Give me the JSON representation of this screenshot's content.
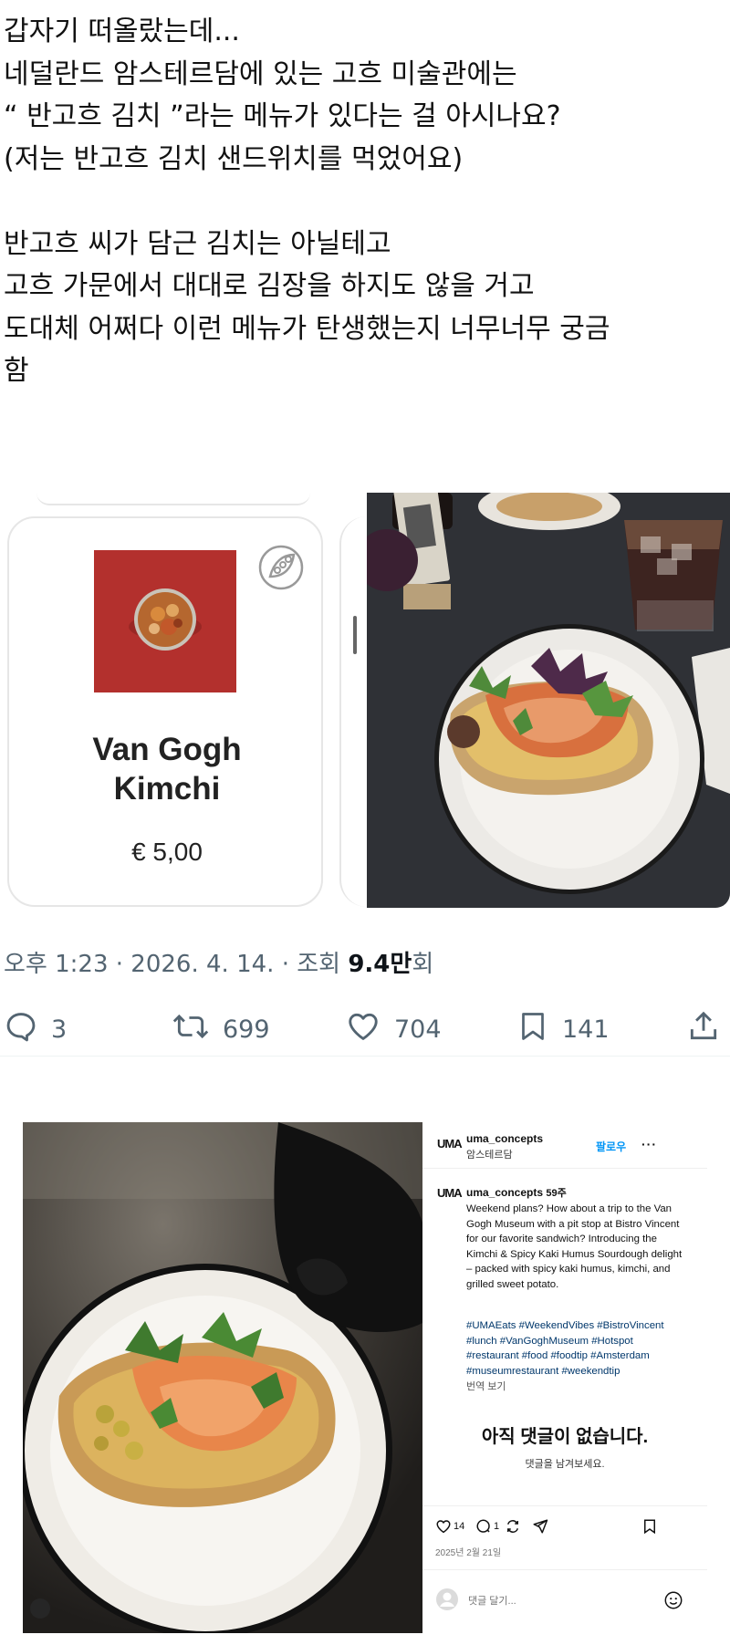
{
  "tweet": {
    "lines": [
      "갑자기 떠올랐는데...",
      "네덜란드 암스테르담에 있는 고흐 미술관에는",
      "“ 반고흐 김치 ”라는 메뉴가 있다는 걸 아시나요?",
      "(저는 반고흐 김치 샌드위치를 먹었어요)",
      "",
      "반고흐 씨가 담근 김치는 아닐테고",
      "고흐 가문에서 대대로 김장을 하지도 않을 거고",
      "도대체 어쩌다 이런 메뉴가 탄생했는지 너무너무 궁금",
      "함"
    ],
    "menu_item": {
      "name_line1": "Van Gogh",
      "name_line2": "Kimchi",
      "price": "€ 5,00"
    },
    "meta": {
      "time": "오후 1:23",
      "date": "2026. 4. 14.",
      "views_prefix": "조회",
      "views_value": "9.4",
      "views_unit": "만",
      "views_suffix": "회",
      "separator": "·"
    },
    "actions": {
      "replies": "3",
      "retweets": "699",
      "likes": "704",
      "bookmarks": "141"
    }
  },
  "instagram": {
    "logo": "UMA",
    "account": "uma_concepts",
    "location": "암스테르담",
    "follow_label": "팔로우",
    "more": "···",
    "post_age": "59주",
    "caption": "Weekend plans? How about a trip to the Van Gogh Museum with a pit stop at Bistro Vincent for our favorite sandwich? Introducing the Kimchi & Spicy Kaki Humus Sourdough delight – packed with spicy kaki humus, kimchi, and grilled sweet potato.",
    "hashtags": "#UMAEats #WeekendVibes #BistroVincent #lunch #VanGoghMuseum #Hotspot #restaurant #food #foodtip #Amsterdam #museumrestaurant #weekendtip",
    "translate": "번역 보기",
    "no_comments": "아직 댓글이 없습니다.",
    "leave_comment": "댓글을 남겨보세요.",
    "like_count": "14",
    "comment_count": "1",
    "date": "2025년 2월 21일",
    "comment_placeholder": "댓글 달기..."
  },
  "colors": {
    "muted": "#536471",
    "link": "#00376b",
    "follow": "#0095f6",
    "menu_bg": "#b3302d"
  }
}
